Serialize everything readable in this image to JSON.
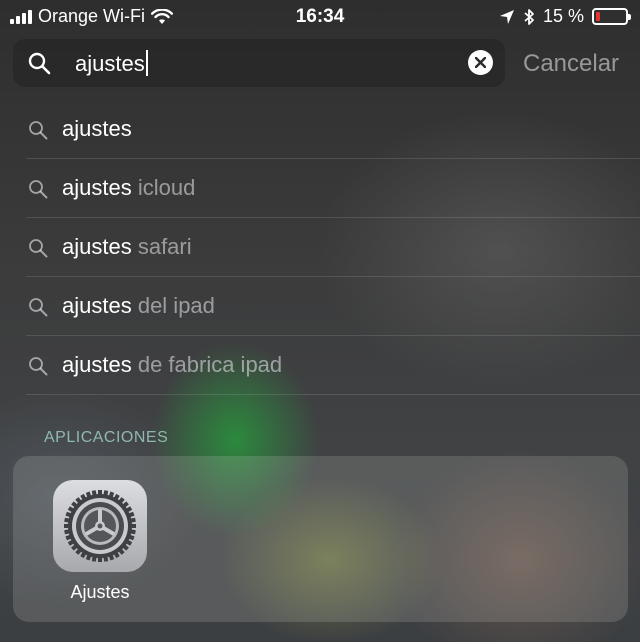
{
  "status_bar": {
    "carrier": "Orange Wi-Fi",
    "time": "16:34",
    "battery_text": "15 %",
    "battery_level": 0.15,
    "battery_color": "#e33333"
  },
  "search": {
    "value": "ajustes",
    "cancel_label": "Cancelar"
  },
  "suggestions": [
    {
      "bold": "ajustes",
      "rest": ""
    },
    {
      "bold": "ajustes",
      "rest": " icloud"
    },
    {
      "bold": "ajustes",
      "rest": " safari"
    },
    {
      "bold": "ajustes",
      "rest": " del ipad"
    },
    {
      "bold": "ajustes",
      "rest": " de fabrica ipad"
    }
  ],
  "apps_section": {
    "title": "APLICACIONES",
    "apps": [
      {
        "name": "Ajustes",
        "icon": "settings-gear-icon"
      }
    ]
  },
  "colors": {
    "section_title": "#aadcd2",
    "secondary_text": "#ebebf0"
  }
}
